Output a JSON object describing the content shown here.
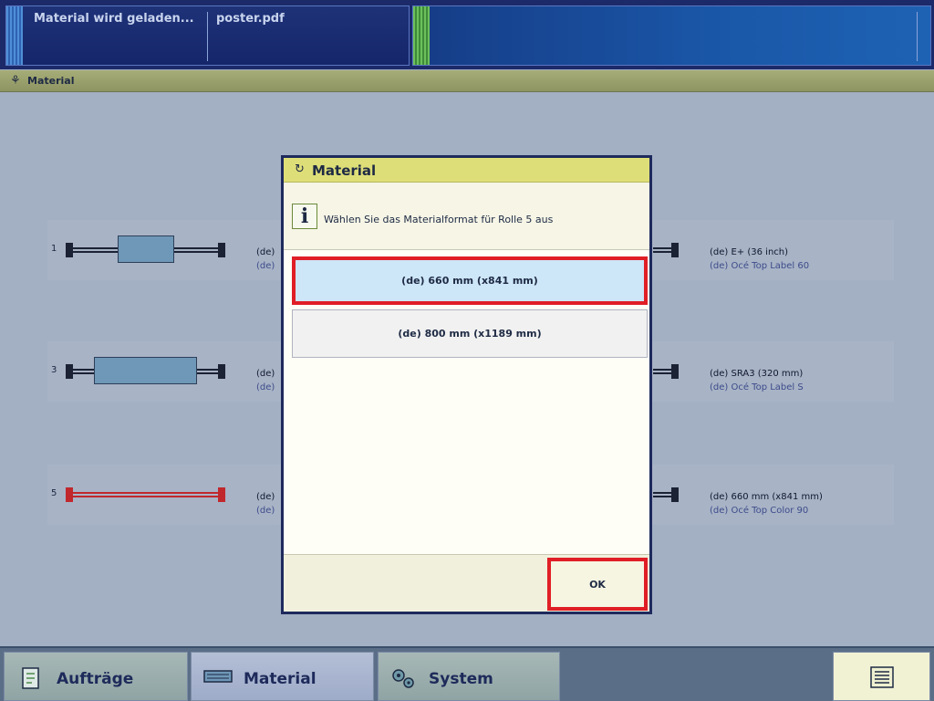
{
  "topbar": {
    "status": "Material wird geladen...",
    "file": "poster.pdf"
  },
  "titlebar": {
    "title": "Material"
  },
  "rolls": [
    {
      "number": "1",
      "right_label": "(de) E+ (36 inch)",
      "right_sub": "(de) Océ Top Label 60",
      "left_label": "(de)",
      "left_sub": "(de)"
    },
    {
      "number": "3",
      "right_label": "(de) SRA3 (320 mm)",
      "right_sub": "(de) Océ Top Label S",
      "left_label": "(de)",
      "left_sub": "(de)"
    },
    {
      "number": "5",
      "right_label": "(de) 660 mm (x841 mm)",
      "right_sub": "(de) Océ Top Color 90",
      "left_label": "(de)",
      "left_sub": "(de)"
    }
  ],
  "dialog": {
    "title": "Material",
    "info_text": "Wählen Sie das Materialformat für Rolle 5 aus",
    "options": [
      "(de) 660 mm (x841 mm)",
      "(de) 800 mm (x1189 mm)"
    ],
    "selected_index": 0,
    "ok_label": "OK"
  },
  "nav": {
    "auftraege": "Aufträge",
    "material": "Material",
    "system": "System"
  },
  "colors": {
    "highlight": "#e01e26",
    "selected_option": "#cde6f8",
    "dialog_header": "#dede78"
  }
}
